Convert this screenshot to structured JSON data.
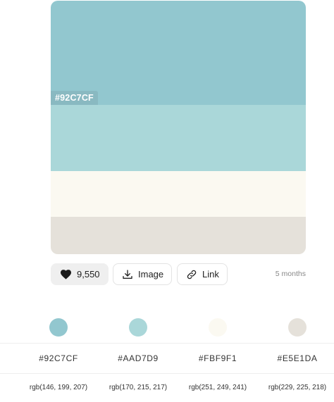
{
  "palette": {
    "swatches": [
      {
        "hex": "#92C7CF",
        "color": "#92C7CF",
        "label_visible": true
      },
      {
        "hex": "#AAD7D9",
        "color": "#AAD7D9",
        "label_visible": false
      },
      {
        "hex": "#FBF9F1",
        "color": "#FBF9F1",
        "label_visible": false
      },
      {
        "hex": "#E5E1DA",
        "color": "#E5E1DA",
        "label_visible": false
      }
    ],
    "hover_label": "#92C7CF"
  },
  "actions": {
    "likes": "9,550",
    "image_label": "Image",
    "link_label": "Link",
    "age": "5 months"
  },
  "colors": [
    {
      "hex": "#92C7CF",
      "rgb": "rgb(146, 199, 207)",
      "swatch": "#92C7CF"
    },
    {
      "hex": "#AAD7D9",
      "rgb": "rgb(170, 215, 217)",
      "swatch": "#AAD7D9"
    },
    {
      "hex": "#FBF9F1",
      "rgb": "rgb(251, 249, 241)",
      "swatch": "#FBF9F1"
    },
    {
      "hex": "#E5E1DA",
      "rgb": "rgb(229, 225, 218)",
      "swatch": "#E5E1DA"
    }
  ],
  "icons": {
    "like": "heart-icon",
    "image": "download-icon",
    "link": "link-icon"
  }
}
